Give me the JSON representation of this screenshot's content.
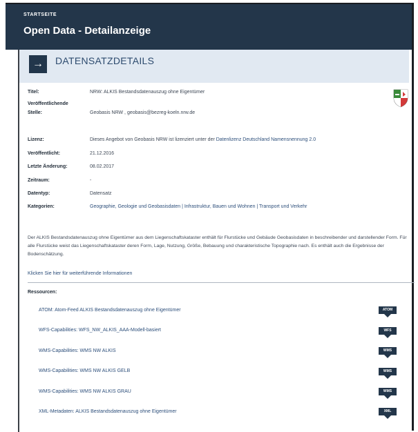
{
  "header": {
    "breadcrumb": "STARTSEITE",
    "title": "Open Data - Detailanzeige"
  },
  "panel": {
    "title": "DATENSATZDETAILS",
    "arrow_icon": "arrow-right-icon"
  },
  "details": {
    "titel_label": "Titel:",
    "titel_value": "NRW: ALKIS Bestandsdatenauszug ohne Eigentümer",
    "stelle_label_1": "Veröffentlichende",
    "stelle_label_2": "Stelle:",
    "stelle_value": "Geobasis NRW , geobasis@bezreg-koeln.nrw.de",
    "lizenz_label": "Lizenz:",
    "lizenz_text": "Dieses Angebot von Geobasis NRW ist lizenziert unter der ",
    "lizenz_link": "Datenlizenz Deutschland Namensnennung 2.0",
    "veroeff_label": "Veröffentlicht:",
    "veroeff_value": "21.12.2016",
    "aenderung_label": "Letzte Änderung:",
    "aenderung_value": "08.02.2017",
    "zeitraum_label": "Zeitraum:",
    "zeitraum_value": "-",
    "datentyp_label": "Datentyp:",
    "datentyp_value": "Datensatz",
    "kategorien_label": "Kategorien:",
    "kategorien_value": "Geographie, Geologie und Geobasisdaten | Infrastruktur, Bauen und Wohnen | Transport und Verkehr"
  },
  "description": "Der ALKIS Bestandsdatenauszug ohne Eigentümer aus dem Liegenschaftskataster enthält für Flurstücke und Gebäude Geobasisdaten in beschreibender und darstellender Form. Für alle Flurstücke weist das Liegenschaftskataster deren Form, Lage, Nutzung, Größe, Bebauung und charakteristische Topographie nach. Es enthält auch die Ergebnisse der Bodenschätzung.",
  "more_link": "Klicken Sie hier für weiterführende Informationen",
  "resources": {
    "heading": "Ressourcen:",
    "items": [
      {
        "label": "ATOM: Atom-Feed ALKIS Bestandsdatenauszug ohne Eigentümer",
        "badge": "ATOM"
      },
      {
        "label": "WFS-Capabilities: WFS_NW_ALKIS_AAA-Modell-basiert",
        "badge": "WFS"
      },
      {
        "label": "WMS-Capabilities: WMS NW ALKIS",
        "badge": "WMS"
      },
      {
        "label": "WMS-Capabilities: WMS NW ALKIS GELB",
        "badge": "WMS"
      },
      {
        "label": "WMS-Capabilities: WMS NW ALKIS GRAU",
        "badge": "WMS"
      },
      {
        "label": "XML-Metadaten: ALKIS Bestandsdatenauszug ohne Eigentümer",
        "badge": "XML"
      }
    ]
  },
  "colors": {
    "header_bg": "#23364a",
    "panel_bg": "#e1e9f2",
    "link": "#2c4e7a"
  }
}
